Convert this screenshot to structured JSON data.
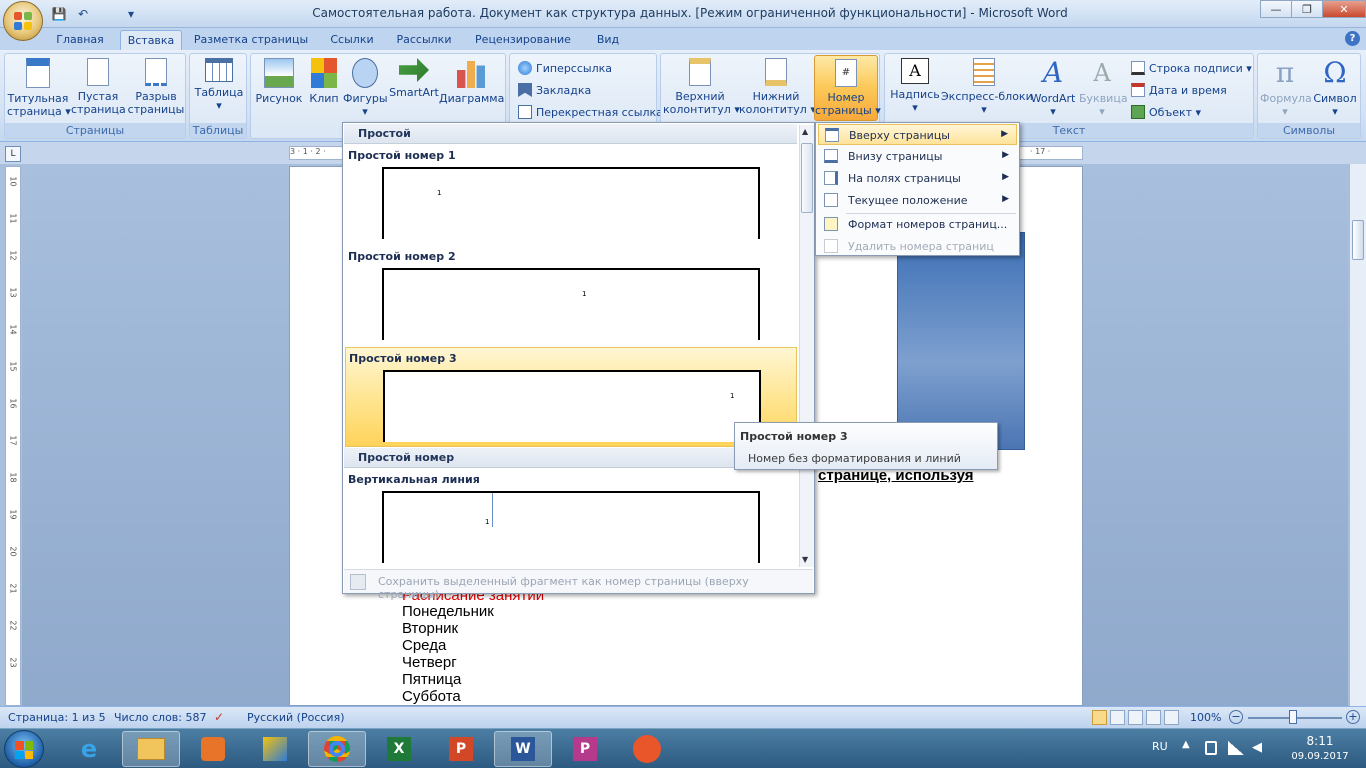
{
  "window": {
    "title": "Самостоятельная работа. Документ как структура данных. [Режим ограниченной функциональности] - Microsoft Word",
    "min": "—",
    "max": "❐",
    "close": "✕"
  },
  "qat": {
    "save": "💾",
    "undo": "↶",
    "redo": "↷",
    "more": "▾"
  },
  "tabs": [
    "Главная",
    "Вставка",
    "Разметка страницы",
    "Ссылки",
    "Рассылки",
    "Рецензирование",
    "Вид"
  ],
  "help": "?",
  "ribbon": {
    "pages": {
      "label": "Страницы",
      "cover": "Титульная\nстраница ▾",
      "blank": "Пустая\nстраница",
      "break": "Разрыв\nстраницы"
    },
    "tables": {
      "label": "Таблицы",
      "table": "Таблица\n▾"
    },
    "illus": {
      "picture": "Рисунок",
      "clip": "Клип",
      "shapes": "Фигуры\n▾",
      "smartart": "SmartArt",
      "chart": "Диаграмма"
    },
    "links": {
      "hyperlink": "Гиперссылка",
      "bookmark": "Закладка",
      "crossref": "Перекрестная ссылка"
    },
    "hf": {
      "header": "Верхний\nколонтитул ▾",
      "footer": "Нижний\nколонтитул ▾",
      "pagenum": "Номер\nстраницы ▾"
    },
    "text": {
      "label": "Текст",
      "textbox": "Надпись\n▾",
      "quickparts": "Экспресс-блоки\n▾",
      "wordart": "WordArt\n▾",
      "dropcap": "Буквица\n▾",
      "sigline": "Строка подписи ▾",
      "datetime": "Дата и время",
      "object": "Объект ▾"
    },
    "symbols": {
      "label": "Символы",
      "formula": "Формула\n▾",
      "symbol": "Символ\n▾"
    }
  },
  "ruler": {
    "corner": "L",
    "htext_left": "3 · 1 · 2 ·",
    "htext_right": "· 17 ·",
    "vnums": [
      "10",
      "11",
      "12",
      "13",
      "14",
      "15",
      "16",
      "17",
      "18",
      "19",
      "20",
      "21",
      "22",
      "23"
    ]
  },
  "document": {
    "heading_frag": "странице, используя",
    "red_frag": "Расписание занятий",
    "days": [
      "Понедельник",
      "Вторник",
      "Среда",
      "Четверг",
      "Пятница",
      "Суббота"
    ]
  },
  "gallery": {
    "cat1": "Простой",
    "items": [
      {
        "name": "Простой номер 1",
        "num": "1"
      },
      {
        "name": "Простой номер 2",
        "num": "1"
      },
      {
        "name": "Простой номер 3",
        "num": "1"
      }
    ],
    "cat2": "Простой номер",
    "item4": {
      "name": "Вертикальная линия",
      "num": "1"
    },
    "footer": "Сохранить выделенный фрагмент как номер страницы (вверху страницы)"
  },
  "menu": {
    "top": "Вверху страницы",
    "bottom": "Внизу страницы",
    "margins": "На полях страницы",
    "current": "Текущее положение",
    "format": "Формат номеров страниц...",
    "remove": "Удалить номера страниц"
  },
  "tooltip": {
    "title": "Простой номер 3",
    "desc": "Номер без форматирования и линий"
  },
  "status": {
    "page": "Страница: 1 из 5",
    "words": "Число слов: 587",
    "lang": "Русский (Россия)",
    "zoom": "100%"
  },
  "tray": {
    "lang": "RU",
    "time": "8:11",
    "date": "09.09.2017"
  }
}
